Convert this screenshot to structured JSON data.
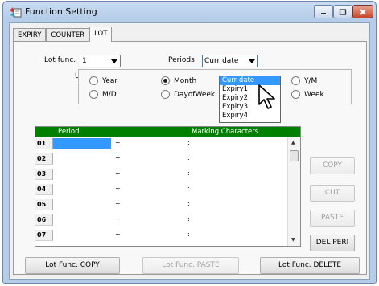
{
  "window": {
    "title": "Function Setting"
  },
  "tabs": [
    "EXPIRY",
    "COUNTER",
    "LOT"
  ],
  "lot_func": {
    "label": "Lot func.",
    "value": "1"
  },
  "periods": {
    "label": "Periods",
    "value": "Curr date",
    "options": [
      "Curr date",
      "Expiry1",
      "Expiry2",
      "Expiry3",
      "Expiry4"
    ],
    "selected_index": 0
  },
  "unit": {
    "label": "Unit",
    "options": [
      {
        "label": "Year",
        "checked": false
      },
      {
        "label": "Month",
        "checked": true
      },
      {
        "label": "Y/M",
        "checked": false
      },
      {
        "label": "M/D",
        "checked": false
      },
      {
        "label": "DayofWeek",
        "checked": false
      },
      {
        "label": "Week",
        "checked": false
      }
    ]
  },
  "grid": {
    "headers": [
      "Period",
      "Marking Characters"
    ],
    "rows": [
      {
        "num": "01",
        "tilde": "~",
        "colon": ":"
      },
      {
        "num": "02",
        "tilde": "~",
        "colon": ":"
      },
      {
        "num": "03",
        "tilde": "~",
        "colon": ":"
      },
      {
        "num": "04",
        "tilde": "~",
        "colon": ":"
      },
      {
        "num": "05",
        "tilde": "~",
        "colon": ":"
      },
      {
        "num": "06",
        "tilde": "~",
        "colon": ":"
      },
      {
        "num": "07",
        "tilde": "~",
        "colon": ":"
      }
    ]
  },
  "side_buttons": {
    "copy": "COPY",
    "cut": "CUT",
    "paste": "PASTE",
    "del_peri": "DEL PERI"
  },
  "bottom_buttons": {
    "copy": "Lot Func. COPY",
    "paste": "Lot Func. PASTE",
    "delete": "Lot Func. DELETE"
  },
  "colors": {
    "grid_header": "#008000",
    "selection": "#3399ff"
  },
  "icons": [
    "app-icon",
    "minimize-icon",
    "maximize-icon",
    "close-icon",
    "dropdown-arrow-icon",
    "cursor-icon"
  ]
}
